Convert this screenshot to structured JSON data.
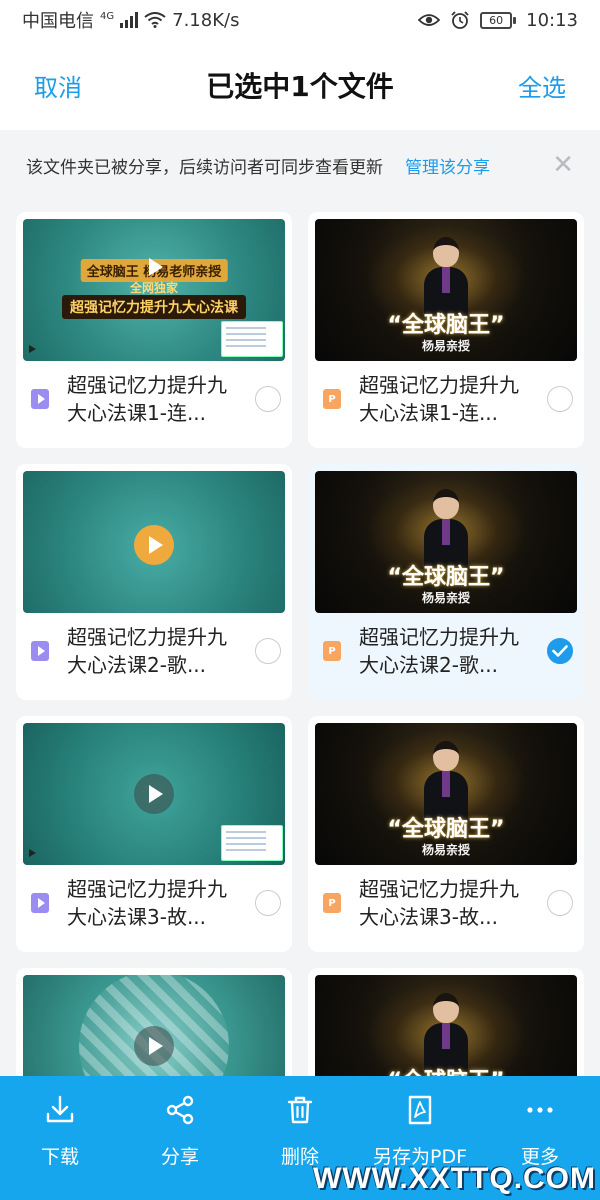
{
  "status_bar": {
    "carrier": "中国电信",
    "network": "4G",
    "speed": "7.18K/s",
    "battery": "60",
    "time": "10:13"
  },
  "nav": {
    "cancel": "取消",
    "title": "已选中1个文件",
    "select_all": "全选"
  },
  "notice": {
    "text": "该文件夹已被分享，后续访问者可同步查看更新",
    "link": "管理该分享",
    "close": "✕"
  },
  "files": [
    {
      "name": "超强记忆力提升九大心法课1-连...",
      "type": "video",
      "thumb": "video-a",
      "selected": false,
      "banner_1": "全球脑王 杨易老师亲授",
      "banner_2": "全网独家",
      "banner_3": "超强记忆力提升九大心法课"
    },
    {
      "name": "超强记忆力提升九大心法课1-连...",
      "type": "pdf",
      "thumb": "pdf",
      "selected": false,
      "thumb_title": "“全球脑王”",
      "thumb_subtitle": "杨易亲授"
    },
    {
      "name": "超强记忆力提升九大心法课2-歌...",
      "type": "video",
      "thumb": "video-b",
      "selected": false
    },
    {
      "name": "超强记忆力提升九大心法课2-歌...",
      "type": "pdf",
      "thumb": "pdf",
      "selected": true,
      "thumb_title": "“全球脑王”",
      "thumb_subtitle": "杨易亲授"
    },
    {
      "name": "超强记忆力提升九大心法课3-故...",
      "type": "video",
      "thumb": "video-c",
      "selected": false
    },
    {
      "name": "超强记忆力提升九大心法课3-故...",
      "type": "pdf",
      "thumb": "pdf",
      "selected": false,
      "thumb_title": "“全球脑王”",
      "thumb_subtitle": "杨易亲授"
    },
    {
      "name": "",
      "type": "video",
      "thumb": "video-d",
      "selected": false
    },
    {
      "name": "",
      "type": "pdf",
      "thumb": "pdf",
      "selected": false,
      "thumb_title": "“全球脑王”",
      "thumb_subtitle": ""
    }
  ],
  "bottom_actions": [
    {
      "label": "下载",
      "icon": "download-icon"
    },
    {
      "label": "分享",
      "icon": "share-icon"
    },
    {
      "label": "删除",
      "icon": "trash-icon"
    },
    {
      "label": "另存为PDF",
      "icon": "pdf-icon"
    },
    {
      "label": "更多",
      "icon": "more-icon"
    }
  ],
  "watermark": "WWW.XXTTQ.COM",
  "colors": {
    "accent": "#1e9bea",
    "bottom_bar": "#16a6ee",
    "video_icon": "#9b8cf2",
    "pdf_icon": "#f7a561"
  }
}
